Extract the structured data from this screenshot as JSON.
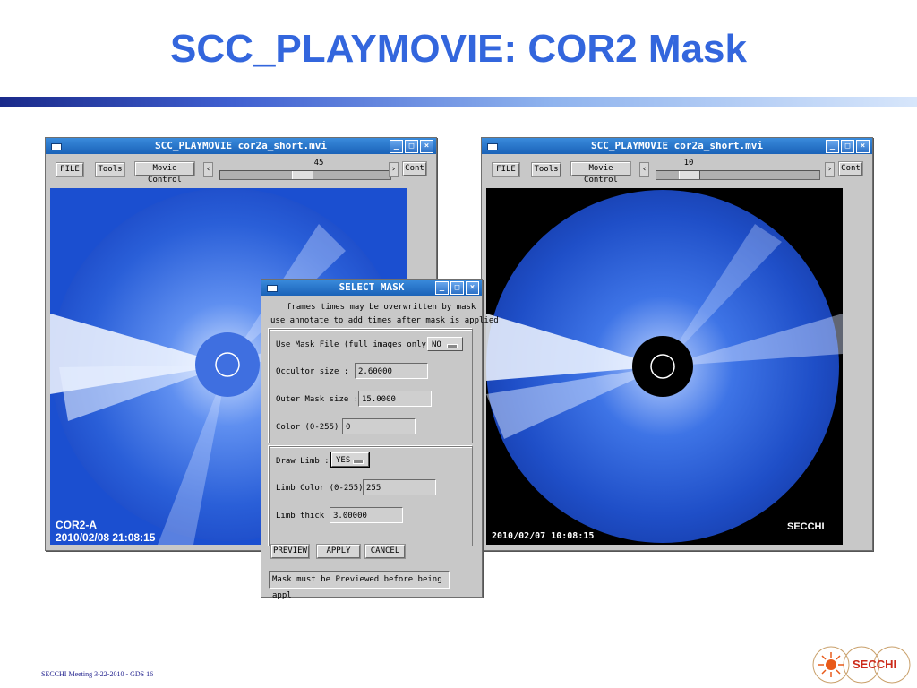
{
  "slide": {
    "title": "SCC_PLAYMOVIE: COR2 Mask",
    "footer": "SECCHI Meeting  3-22-2010  - GDS 16",
    "logo_text": "SECCHI"
  },
  "window_left": {
    "title": "SCC_PLAYMOVIE  cor2a_short.mvi",
    "buttons": {
      "file": "FILE",
      "tools": "Tools",
      "movie_control": "Movie Control",
      "cont": "Cont"
    },
    "slider_value": "45",
    "slider_fraction": 0.48,
    "image": {
      "label_line1": "COR2-A",
      "label_line2": "2010/02/08 21:08:15"
    }
  },
  "window_right": {
    "title": "SCC_PLAYMOVIE  cor2a_short.mvi",
    "buttons": {
      "file": "FILE",
      "tools": "Tools",
      "movie_control": "Movie Control",
      "cont": "Cont"
    },
    "slider_value": "10",
    "slider_fraction": 0.16,
    "image": {
      "timestamp": "2010/02/07  10:08:15",
      "logo": "SECCHI"
    }
  },
  "select_mask": {
    "title": "SELECT MASK",
    "info_line1": "frames times may be overwritten by mask",
    "info_line2": "use annotate to add times after mask is applied",
    "use_mask_file_label": "Use Mask File (full images only):",
    "use_mask_file_value": "NO",
    "occultor_size_label": "Occultor size  :",
    "occultor_size_value": "2.60000",
    "outer_mask_size_label": "Outer Mask size :",
    "outer_mask_size_value": "15.0000",
    "color_label": "Color (0-255)",
    "color_value": "0",
    "draw_limb_label": "Draw Limb :",
    "draw_limb_value": "YES",
    "limb_color_label": "Limb Color (0-255)",
    "limb_color_value": "255",
    "limb_thick_label": "Limb thick",
    "limb_thick_value": "3.00000",
    "preview_button": "PREVIEW",
    "apply_button": "APPLY",
    "cancel_button": "CANCEL",
    "status_message": "Mask must be Previewed before being appl"
  },
  "colors": {
    "title": "#3366dd",
    "titlebar": "#1a62b8",
    "window_bg": "#c8c8c8",
    "cor2_blue": "#1b4fd0"
  }
}
